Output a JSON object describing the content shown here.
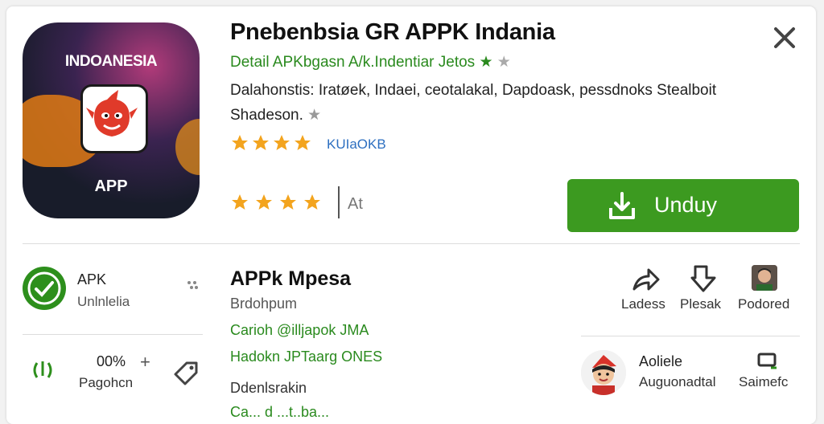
{
  "app": {
    "icon_country": "INDOANESIA",
    "icon_label": "APP",
    "title": "Pnebenbsia GR APPK Indania",
    "subtitle": "Detail APKbgasn A/k.Indentiar Jetos",
    "description": "Dalahonstis: Iratøek, Indaei, ceotalakal, Dapdoask, pessdnoks Stealboit Shadeson.",
    "rating_link": "KUIaOKB",
    "rating_side": "At",
    "download_label": "Unduy"
  },
  "left_panel": {
    "row1_title": "APK",
    "row1_sub": "Unlnlelia",
    "row2_value": "00%",
    "row2_plus": "+",
    "row2_sub": "Pagohcn"
  },
  "middle_panel": {
    "title": "APPk Mpesa",
    "line1": "Brdohpum",
    "line2": "Carioh @illjapok JMA",
    "line3": "Hadokn JPTaarg ONES",
    "line4": "Ddenlsrakin",
    "line5": "Ca... d ...t..ba..."
  },
  "right_panel": {
    "action1": "Ladess",
    "action2": "Plesak",
    "action3": "Podored",
    "user_title": "Aoliele",
    "user_sub": "Auguonadtal",
    "service_label": "Saimefc"
  },
  "colors": {
    "accent_green": "#3c9a20",
    "link_blue": "#2d6fc0",
    "star_gold": "#f3a41e"
  }
}
